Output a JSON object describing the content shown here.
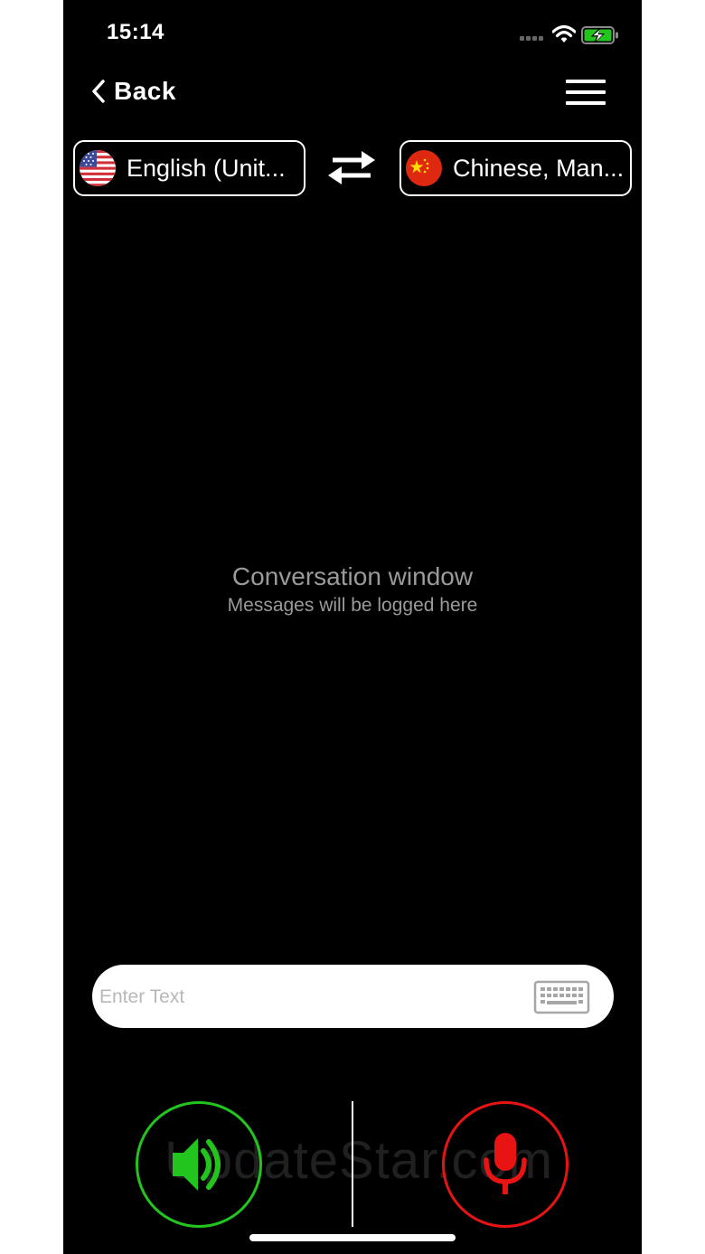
{
  "status_bar": {
    "time": "15:14",
    "icons": [
      "signal-dots-icon",
      "wifi-icon",
      "battery-charging-icon"
    ]
  },
  "nav": {
    "back_label": "Back",
    "back_icon": "chevron-left-icon",
    "menu_icon": "hamburger-menu-icon"
  },
  "languages": {
    "source": {
      "label": "English (Unit...",
      "flag": "us-flag-icon"
    },
    "target": {
      "label": "Chinese, Man...",
      "flag": "china-flag-icon"
    },
    "swap_icon": "swap-arrows-icon"
  },
  "conversation": {
    "title": "Conversation window",
    "subtitle": "Messages will be logged here"
  },
  "input": {
    "placeholder": "Enter Text",
    "value": "",
    "keyboard_icon": "keyboard-icon"
  },
  "controls": {
    "speaker_icon": "speaker-icon",
    "speaker_color": "#22c51e",
    "mic_icon": "microphone-icon",
    "mic_color": "#e81313"
  },
  "watermark": "UpdateStar.com"
}
